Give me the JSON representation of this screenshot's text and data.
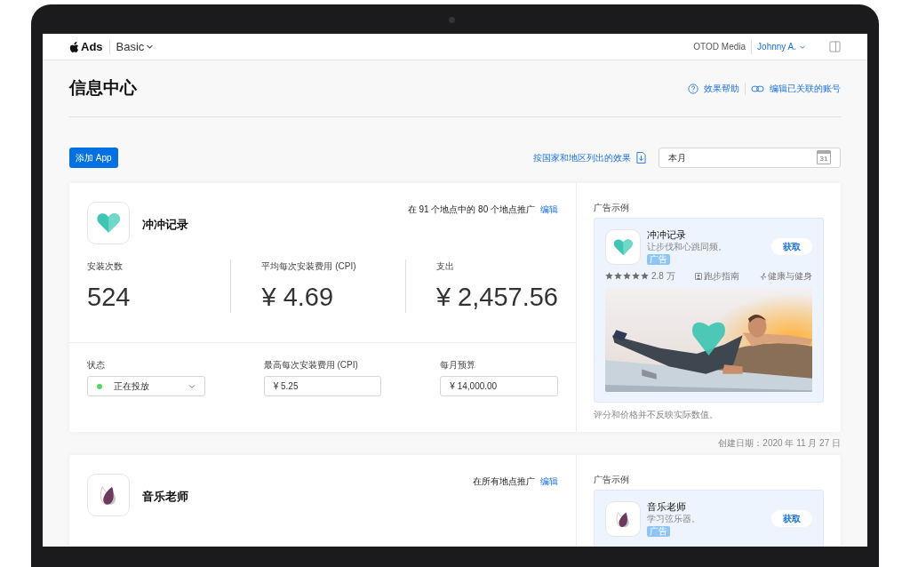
{
  "header": {
    "logo": "Ads",
    "product": "Basic",
    "organization": "OTOD Media",
    "user": "Johnny A."
  },
  "page": {
    "title": "信息中心",
    "links": [
      {
        "kind": "help",
        "text": "效果帮助"
      },
      {
        "kind": "link",
        "text": "编辑已关联的账号"
      }
    ],
    "add_button": "添加 App",
    "export_link": "按国家和地区列出的效果",
    "date_field": {
      "value": "本月",
      "calendar_day": "31"
    }
  },
  "campaigns": [
    {
      "name": "冲冲记录",
      "locations": "在 91 个地点中的 80 个地点推广",
      "edit": "编辑",
      "metrics": [
        {
          "label": "安装次数",
          "value": "524"
        },
        {
          "label": "平均每次安装费用 (CPI)",
          "value": "¥ 4.69"
        },
        {
          "label": "支出",
          "value": "¥ 2,457.56"
        }
      ],
      "settings": {
        "status_label": "状态",
        "status": "正在投放",
        "active": true,
        "max_cpi_label": "最高每次安装费用 (CPI)",
        "max_cpi": "¥ 5.25",
        "budget_label": "每月预算",
        "budget": "¥ 14,000.00"
      },
      "ad_preview": {
        "heading": "广告示例",
        "name": "冲冲记录",
        "subtitle": "让步伐和心跳同频。",
        "badge": "广告",
        "get_button": "获取",
        "stars": 5,
        "rating_count": "2.8 万",
        "developer_tag": "跑步指南",
        "category": "健康与健身",
        "footnote": "评分和价格并不反映实际数值。"
      },
      "created": "创建日期：2020 年 11 月 27 日"
    },
    {
      "name": "音乐老师",
      "locations": "在所有地点推广",
      "edit": "编辑",
      "ad_preview": {
        "heading": "广告示例",
        "name": "音乐老师",
        "subtitle": "学习弦乐器。",
        "badge": "广告",
        "get_button": "获取"
      }
    }
  ]
}
